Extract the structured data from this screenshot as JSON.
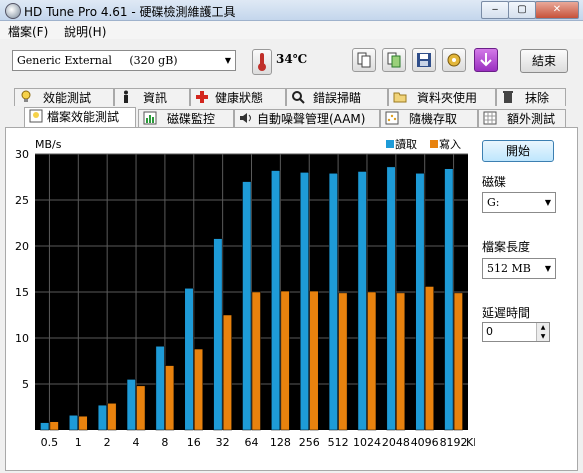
{
  "window": {
    "title": "HD Tune Pro 4.61 - 硬碟檢測維護工具"
  },
  "menu": [
    "檔案(F)",
    "說明(H)"
  ],
  "toolbar": {
    "drive": "Generic External     (320 gB)",
    "temperature": "34℃",
    "exit_label": "結束"
  },
  "tabs_row1": [
    "效能測試",
    "資訊",
    "健康狀態",
    "錯誤掃瞄",
    "資料夾使用",
    "抹除"
  ],
  "tabs_row2": [
    "檔案效能測試",
    "磁碟監控",
    "自動噪聲管理(AAM)",
    "隨機存取",
    "額外測試"
  ],
  "side": {
    "start_label": "開始",
    "disk_label": "磁碟",
    "disk_value": "G:",
    "file_length_label": "檔案長度",
    "file_length_value": "512 MB",
    "delay_label": "延遲時間",
    "delay_value": "0"
  },
  "colors": {
    "read": "#1e9bd7",
    "write": "#e8820e",
    "plot_bg": "#000000"
  },
  "chart_data": {
    "type": "bar",
    "ylabel": "MB/s",
    "xunit": "KB",
    "ylim": [
      0,
      30
    ],
    "yticks": [
      5,
      10,
      15,
      20,
      25,
      30
    ],
    "grid": true,
    "legend": "top-right",
    "categories": [
      "0.5",
      "1",
      "2",
      "4",
      "8",
      "16",
      "32",
      "64",
      "128",
      "256",
      "512",
      "1024",
      "2048",
      "4096",
      "8192"
    ],
    "series": [
      {
        "name": "讀取",
        "values": [
          0.8,
          1.6,
          2.7,
          5.5,
          9.1,
          15.4,
          20.8,
          27.0,
          28.2,
          28.0,
          27.9,
          28.1,
          28.6,
          27.9,
          28.4
        ]
      },
      {
        "name": "寫入",
        "values": [
          0.9,
          1.5,
          2.9,
          4.8,
          7.0,
          8.8,
          12.5,
          15.0,
          15.1,
          15.1,
          14.9,
          15.0,
          14.9,
          15.6,
          14.9
        ]
      }
    ]
  }
}
